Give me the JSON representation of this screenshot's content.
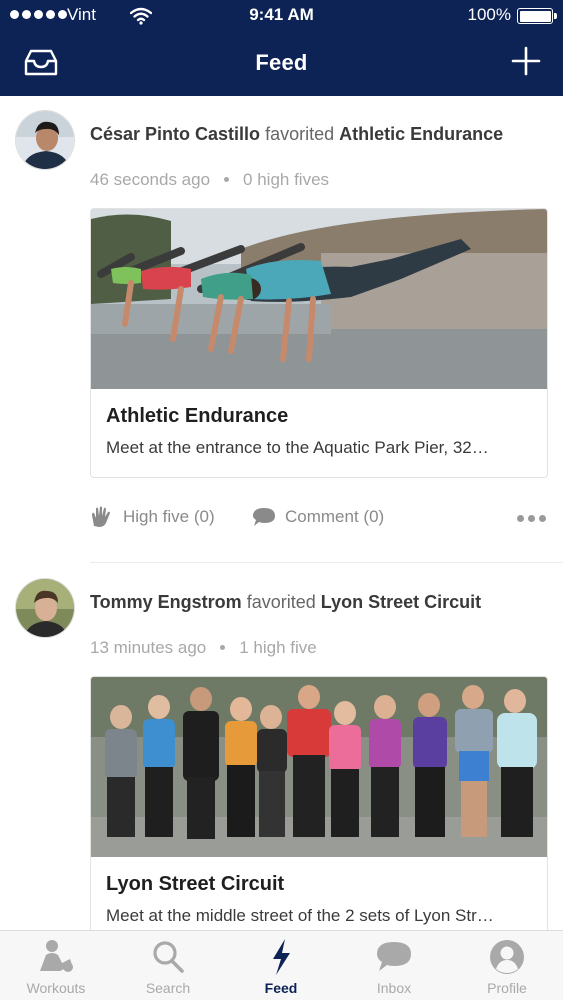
{
  "status_bar": {
    "carrier": "Vint",
    "time": "9:41 AM",
    "battery": "100%"
  },
  "nav": {
    "title": "Feed",
    "left_icon": "inbox-tray-icon",
    "right_icon": "plus-icon"
  },
  "feed": [
    {
      "user": "César Pinto Castillo",
      "verb": "favorited",
      "workout": "Athletic Endurance",
      "time_ago": "46 seconds ago",
      "high_fives": "0 high fives",
      "card_title": "Athletic Endurance",
      "card_desc": "Meet at the entrance to the Aquatic Park Pier, 32…",
      "high_five_label": "High five (0)",
      "comment_label": "Comment (0)"
    },
    {
      "user": "Tommy Engstrom",
      "verb": "favorited",
      "workout": "Lyon Street Circuit",
      "time_ago": "13 minutes ago",
      "high_fives": "1 high five",
      "card_title": "Lyon Street Circuit",
      "card_desc": "Meet at the middle street of the 2 sets of Lyon Str…"
    }
  ],
  "tabs": [
    {
      "label": "Workouts",
      "icon": "workouts-icon"
    },
    {
      "label": "Search",
      "icon": "search-icon"
    },
    {
      "label": "Feed",
      "icon": "bolt-icon",
      "active": true
    },
    {
      "label": "Inbox",
      "icon": "chat-bubble-icon"
    },
    {
      "label": "Profile",
      "icon": "profile-icon"
    }
  ],
  "colors": {
    "navy": "#0d2356",
    "tab_inactive": "#a9a9a9",
    "meta_gray": "#a8a8a8"
  }
}
